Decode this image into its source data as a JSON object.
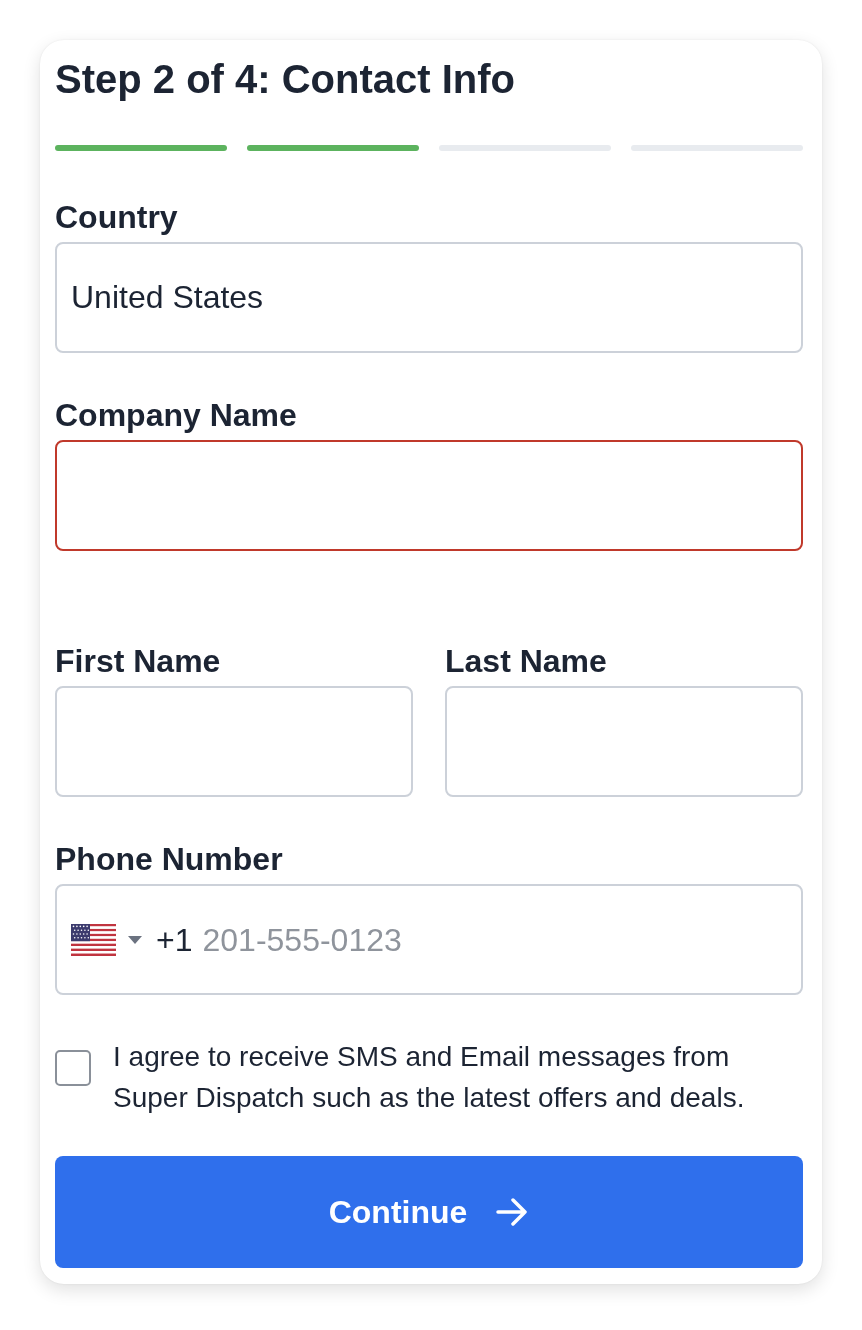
{
  "title": "Step 2 of 4: Contact Info",
  "progress": [
    {
      "complete": true
    },
    {
      "complete": true
    },
    {
      "complete": false
    },
    {
      "complete": false
    }
  ],
  "country": {
    "label": "Country",
    "value": "United States",
    "error": false
  },
  "company_name": {
    "label": "Company Name",
    "error": true
  },
  "name_fields": [
    {
      "label": "First Name",
      "error": false
    },
    {
      "label": "Last Name",
      "error": false
    }
  ],
  "phone": {
    "label": "Phone Number",
    "dial_code": "+1",
    "placeholder": "201-555-0123",
    "error": false
  },
  "consent": {
    "checked": false,
    "text": "I agree to receive SMS and Email messages from Super Dispatch such as the latest offers and deals."
  },
  "continue_button": {
    "label": "Continue"
  }
}
